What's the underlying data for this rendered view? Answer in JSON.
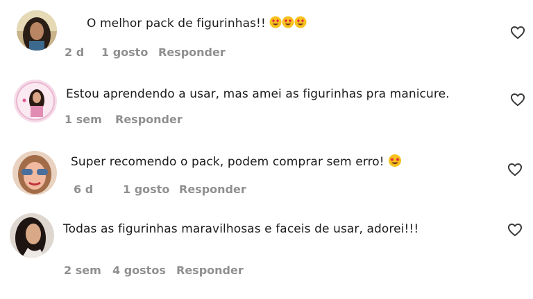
{
  "comments": [
    {
      "text": "O melhor pack de figurinhas!!",
      "emoji": "heart-eyes-face-x3",
      "time": "2 d",
      "likes": "1 gosto",
      "reply": "Responder",
      "avatar": "avatar-woman-dark-hair"
    },
    {
      "text": "Estou aprendendo a usar, mas amei as figurinhas pra manicure.",
      "time": "1 sem",
      "likes": "",
      "reply": "Responder",
      "avatar": "avatar-woman-pink-background"
    },
    {
      "text": "Super recomendo o pack, podem comprar sem erro!",
      "emoji": "star-struck-face",
      "time": "6 d",
      "likes": "1 gosto",
      "reply": "Responder",
      "avatar": "avatar-woman-sunglasses"
    },
    {
      "text": "Todas as figurinhas maravilhosas e faceis de usar, adorei!!!",
      "time": "2 sem",
      "likes": "4 gostos",
      "reply": "Responder",
      "avatar": "avatar-woman-long-dark-hair"
    }
  ],
  "colors": {
    "text": "#1b1b1b",
    "meta": "#8f8f8f",
    "heart_outline": "#3a3a3a"
  },
  "icons": {
    "like": "heart-outline-icon"
  }
}
